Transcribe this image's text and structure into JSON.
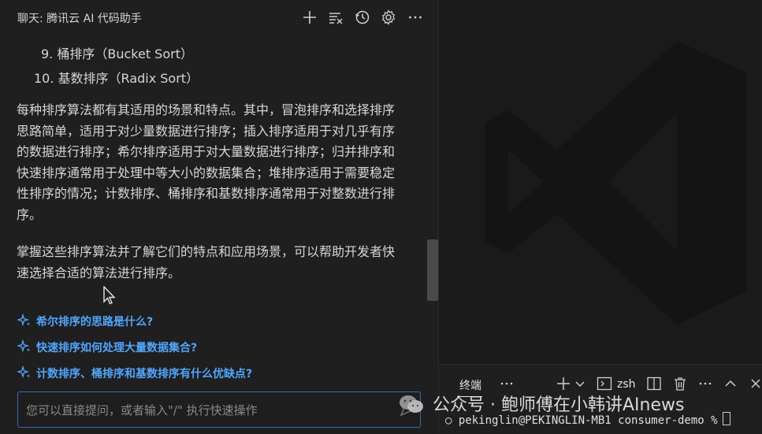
{
  "chat": {
    "title": "聊天: 腾讯云 AI 代码助手",
    "list_items": [
      {
        "num": "9.",
        "text": "桶排序（Bucket Sort）"
      },
      {
        "num": "10.",
        "text": "基数排序（Radix Sort）"
      }
    ],
    "paragraph1_lines": [
      "每种排序算法都有其适用的场景和特点。其中，冒泡排序和选择排序",
      "思路简单，适用于对少量数据进行排序；插入排序适用于对几乎有序",
      "的数据进行排序；希尔排序适用于对大量数据进行排序；归并排序和",
      "快速排序通常用于处理中等大小的数据集合；堆排序适用于需要稳定",
      "性排序的情况；计数排序、桶排序和基数排序通常用于对整数进行排",
      "序。"
    ],
    "paragraph2_lines": [
      "掌握这些排序算法并了解它们的特点和应用场景，可以帮助开发者快",
      "速选择合适的算法进行排序。"
    ],
    "suggestions": [
      "希尔排序的思路是什么?",
      "快速排序如何处理大量数据集合?",
      "计数排序、桶排序和基数排序有什么优缺点?"
    ],
    "input_placeholder": "您可以直接提问，或者输入\"/\" 执行快速操作"
  },
  "terminal": {
    "tab_label": "终端",
    "shell_label": "zsh",
    "prompt_line": "○ pekinglin@PEKINGLIN-MB1 consumer-demo %"
  },
  "watermark": "公众号 · 鲍师傅在小韩讲AInews",
  "colors": {
    "accent_link": "#4ea7ff",
    "input_border": "#2f6fb6",
    "background": "#1f1f1f"
  },
  "icons": [
    "plus-icon",
    "clear-icon",
    "history-icon",
    "gear-icon",
    "more-icon",
    "sparkle-icon",
    "send-icon",
    "vscode-logo",
    "chevron-down-icon",
    "terminal-icon",
    "split-icon",
    "trash-icon",
    "chevron-up-icon",
    "close-icon"
  ]
}
